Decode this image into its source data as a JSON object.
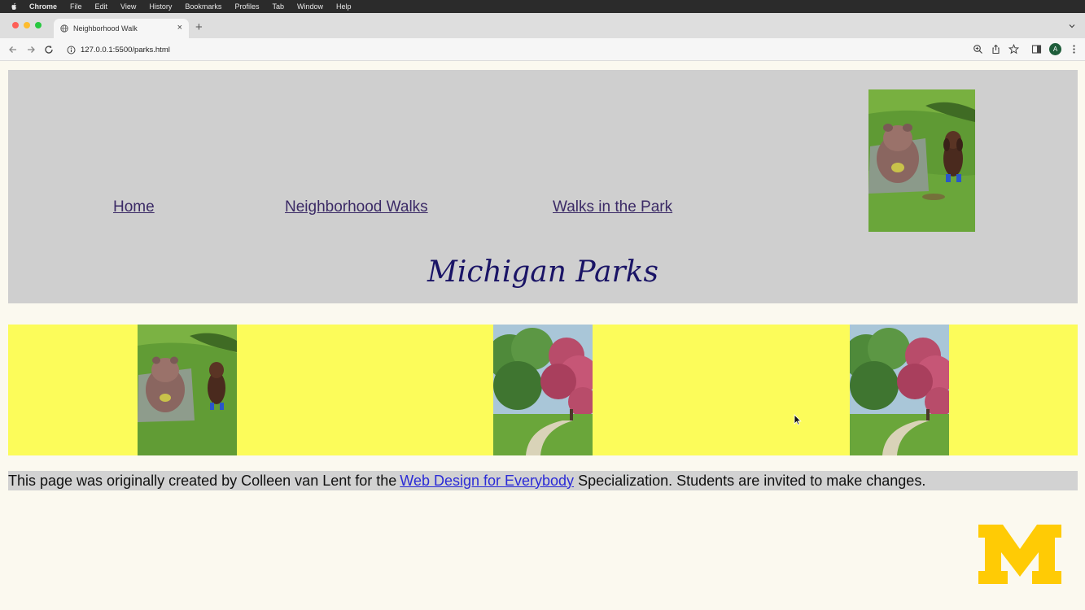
{
  "menubar": {
    "items": [
      "Chrome",
      "File",
      "Edit",
      "View",
      "History",
      "Bookmarks",
      "Profiles",
      "Tab",
      "Window",
      "Help"
    ]
  },
  "browser": {
    "tab_title": "Neighborhood Walk",
    "new_tab": "+",
    "url": "127.0.0.1:5500/parks.html",
    "avatar_initial": "A"
  },
  "nav": {
    "links": [
      "Home",
      "Neighborhood Walks",
      "Walks in the Park"
    ]
  },
  "page": {
    "title": "Michigan Parks"
  },
  "footer": {
    "text_before": "This page was originally created by Colleen van Lent for the",
    "link_text": "Web Design for Everybody",
    "text_after": "Specialization. Students are invited to make changes."
  },
  "colors": {
    "header_bg": "#cfcfcf",
    "gallery_bg": "#fcfc5a",
    "page_bg": "#fbf9ef",
    "title_color": "#1a1466",
    "um_maize": "#ffcb05"
  },
  "icons": [
    "apple-icon",
    "globe-icon",
    "close-icon",
    "back-icon",
    "forward-icon",
    "reload-icon",
    "info-icon",
    "zoom-icon",
    "share-icon",
    "star-icon",
    "sidebar-icon",
    "menu-icon"
  ]
}
